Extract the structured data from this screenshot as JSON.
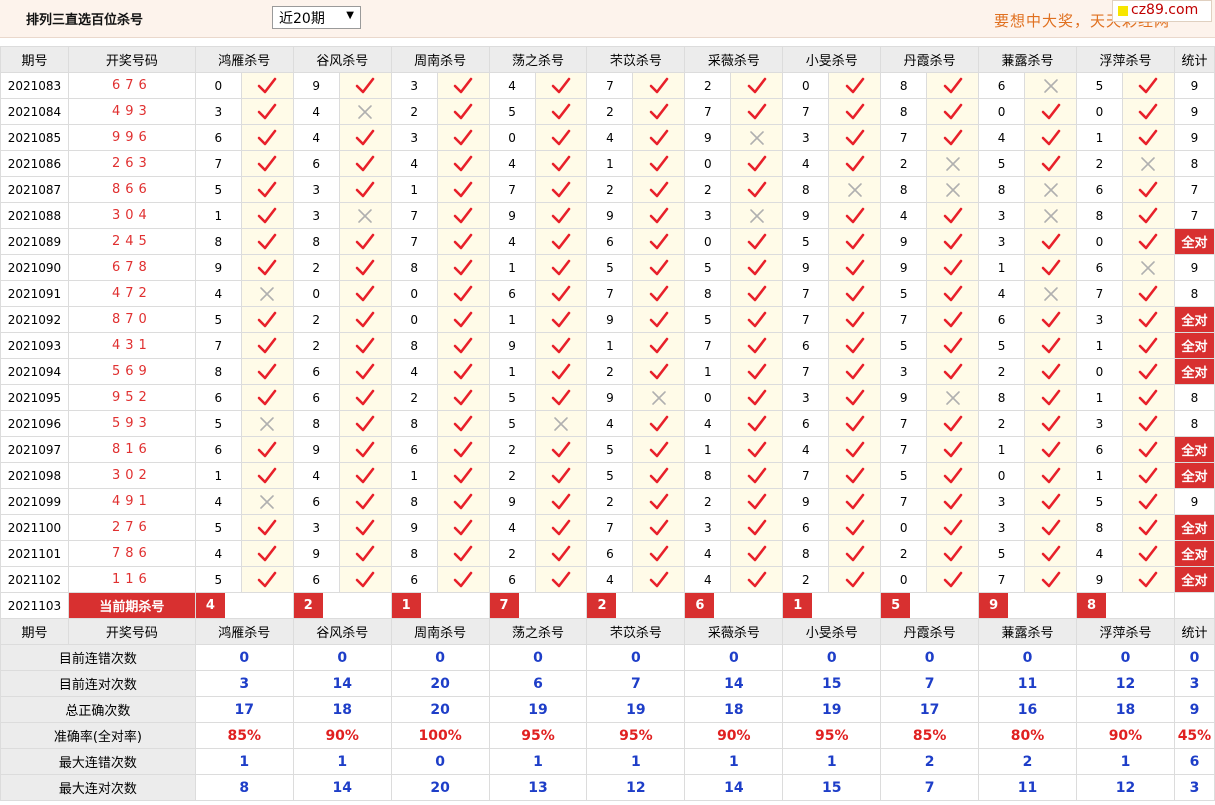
{
  "page": {
    "title": "排列三直选百位杀号",
    "period_select": "近20期",
    "marquee": "要想中大奖，天天彩经网",
    "logo": "cz89.com"
  },
  "colors": {
    "accent": "#d83030",
    "check": "#e8202a",
    "cross": "#b0b0b0",
    "blue": "#1e3ec8",
    "red": "#e02020"
  },
  "headers": [
    "期号",
    "开奖号码",
    "鸿雁杀号",
    "谷风杀号",
    "周南杀号",
    "荡之杀号",
    "芣苡杀号",
    "采薇杀号",
    "小旻杀号",
    "丹霞杀号",
    "蒹露杀号",
    "浮萍杀号",
    "统计"
  ],
  "rows": [
    {
      "issue": "2021083",
      "draw": "676",
      "kills": [
        "0",
        "9",
        "3",
        "4",
        "7",
        "2",
        "0",
        "8",
        "6",
        "5"
      ],
      "marks": "1111111101",
      "count": "9"
    },
    {
      "issue": "2021084",
      "draw": "493",
      "kills": [
        "3",
        "4",
        "2",
        "5",
        "2",
        "7",
        "7",
        "8",
        "0",
        "0"
      ],
      "marks": "1011111111",
      "count": "9"
    },
    {
      "issue": "2021085",
      "draw": "996",
      "kills": [
        "6",
        "4",
        "3",
        "0",
        "4",
        "9",
        "3",
        "7",
        "4",
        "1"
      ],
      "marks": "1111101111",
      "count": "9"
    },
    {
      "issue": "2021086",
      "draw": "263",
      "kills": [
        "7",
        "6",
        "4",
        "4",
        "1",
        "0",
        "4",
        "2",
        "5",
        "2"
      ],
      "marks": "1111111010",
      "count": "8"
    },
    {
      "issue": "2021087",
      "draw": "866",
      "kills": [
        "5",
        "3",
        "1",
        "7",
        "2",
        "2",
        "8",
        "8",
        "8",
        "6"
      ],
      "marks": "1111110001",
      "count": "7"
    },
    {
      "issue": "2021088",
      "draw": "304",
      "kills": [
        "1",
        "3",
        "7",
        "9",
        "9",
        "3",
        "9",
        "4",
        "3",
        "8"
      ],
      "marks": "1011101101",
      "count": "7"
    },
    {
      "issue": "2021089",
      "draw": "245",
      "kills": [
        "8",
        "8",
        "7",
        "4",
        "6",
        "0",
        "5",
        "9",
        "3",
        "0"
      ],
      "marks": "1111111111",
      "count": "全对"
    },
    {
      "issue": "2021090",
      "draw": "678",
      "kills": [
        "9",
        "2",
        "8",
        "1",
        "5",
        "5",
        "9",
        "9",
        "1",
        "6"
      ],
      "marks": "1111111110",
      "count": "9"
    },
    {
      "issue": "2021091",
      "draw": "472",
      "kills": [
        "4",
        "0",
        "0",
        "6",
        "7",
        "8",
        "7",
        "5",
        "4",
        "7"
      ],
      "marks": "0111111101",
      "count": "8"
    },
    {
      "issue": "2021092",
      "draw": "870",
      "kills": [
        "5",
        "2",
        "0",
        "1",
        "9",
        "5",
        "7",
        "7",
        "6",
        "3"
      ],
      "marks": "1111111111",
      "count": "全对"
    },
    {
      "issue": "2021093",
      "draw": "431",
      "kills": [
        "7",
        "2",
        "8",
        "9",
        "1",
        "7",
        "6",
        "5",
        "5",
        "1"
      ],
      "marks": "1111111111",
      "count": "全对"
    },
    {
      "issue": "2021094",
      "draw": "569",
      "kills": [
        "8",
        "6",
        "4",
        "1",
        "2",
        "1",
        "7",
        "3",
        "2",
        "0"
      ],
      "marks": "1111111111",
      "count": "全对"
    },
    {
      "issue": "2021095",
      "draw": "952",
      "kills": [
        "6",
        "6",
        "2",
        "5",
        "9",
        "0",
        "3",
        "9",
        "8",
        "1"
      ],
      "marks": "1111011011",
      "count": "8"
    },
    {
      "issue": "2021096",
      "draw": "593",
      "kills": [
        "5",
        "8",
        "8",
        "5",
        "4",
        "4",
        "6",
        "7",
        "2",
        "3"
      ],
      "marks": "0110111111",
      "count": "8"
    },
    {
      "issue": "2021097",
      "draw": "816",
      "kills": [
        "6",
        "9",
        "6",
        "2",
        "5",
        "1",
        "4",
        "7",
        "1",
        "6"
      ],
      "marks": "1111111111",
      "count": "全对"
    },
    {
      "issue": "2021098",
      "draw": "302",
      "kills": [
        "1",
        "4",
        "1",
        "2",
        "5",
        "8",
        "7",
        "5",
        "0",
        "1"
      ],
      "marks": "1111111111",
      "count": "全对"
    },
    {
      "issue": "2021099",
      "draw": "491",
      "kills": [
        "4",
        "6",
        "8",
        "9",
        "2",
        "2",
        "9",
        "7",
        "3",
        "5"
      ],
      "marks": "0111111111",
      "count": "9"
    },
    {
      "issue": "2021100",
      "draw": "276",
      "kills": [
        "5",
        "3",
        "9",
        "4",
        "7",
        "3",
        "6",
        "0",
        "3",
        "8"
      ],
      "marks": "1111111111",
      "count": "全对"
    },
    {
      "issue": "2021101",
      "draw": "786",
      "kills": [
        "4",
        "9",
        "8",
        "2",
        "6",
        "4",
        "8",
        "2",
        "5",
        "4"
      ],
      "marks": "1111111111",
      "count": "全对"
    },
    {
      "issue": "2021102",
      "draw": "116",
      "kills": [
        "5",
        "6",
        "6",
        "6",
        "4",
        "4",
        "2",
        "0",
        "7",
        "9"
      ],
      "marks": "1111111111",
      "count": "全对"
    }
  ],
  "current": {
    "issue": "2021103",
    "label": "当前期杀号",
    "kills": [
      "4",
      "2",
      "1",
      "7",
      "2",
      "6",
      "1",
      "5",
      "9",
      "8"
    ]
  },
  "stats": [
    {
      "label": "目前连错次数",
      "values": [
        "0",
        "0",
        "0",
        "0",
        "0",
        "0",
        "0",
        "0",
        "0",
        "0",
        "0"
      ],
      "style": "blue"
    },
    {
      "label": "目前连对次数",
      "values": [
        "3",
        "14",
        "20",
        "6",
        "7",
        "14",
        "15",
        "7",
        "11",
        "12",
        "3"
      ],
      "style": "blue"
    },
    {
      "label": "总正确次数",
      "values": [
        "17",
        "18",
        "20",
        "19",
        "19",
        "18",
        "19",
        "17",
        "16",
        "18",
        "9"
      ],
      "style": "blue"
    },
    {
      "label": "准确率(全对率)",
      "values": [
        "85%",
        "90%",
        "100%",
        "95%",
        "95%",
        "90%",
        "95%",
        "85%",
        "80%",
        "90%",
        "45%"
      ],
      "style": "red"
    },
    {
      "label": "最大连错次数",
      "values": [
        "1",
        "1",
        "0",
        "1",
        "1",
        "1",
        "1",
        "2",
        "2",
        "1",
        "6"
      ],
      "style": "blue"
    },
    {
      "label": "最大连对次数",
      "values": [
        "8",
        "14",
        "20",
        "13",
        "12",
        "14",
        "15",
        "7",
        "11",
        "12",
        "3"
      ],
      "style": "blue"
    }
  ]
}
